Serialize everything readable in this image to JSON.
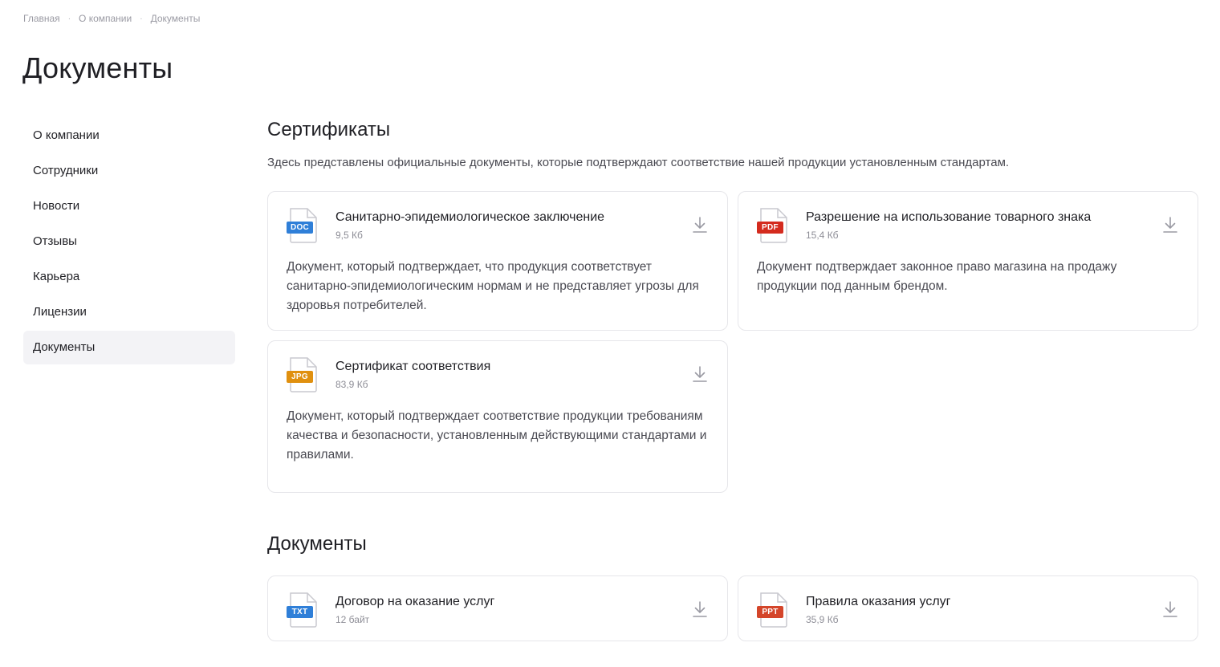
{
  "breadcrumb": [
    {
      "label": "Главная"
    },
    {
      "label": "О компании"
    },
    {
      "label": "Документы"
    }
  ],
  "page_title": "Документы",
  "sidebar": {
    "items": [
      {
        "label": "О компании"
      },
      {
        "label": "Сотрудники"
      },
      {
        "label": "Новости"
      },
      {
        "label": "Отзывы"
      },
      {
        "label": "Карьера"
      },
      {
        "label": "Лицензии"
      },
      {
        "label": "Документы",
        "active": true
      }
    ]
  },
  "colors": {
    "doc": "#2f7fd8",
    "pdf": "#d42b1e",
    "jpg": "#e0900f",
    "txt": "#2f7fd8",
    "ppt": "#d4452a",
    "active_bg": "#f3f3f6"
  },
  "certificates": {
    "title": "Сертификаты",
    "description": "Здесь представлены официальные документы, которые подтверждают соответствие нашей продукции установленным стандартам.",
    "items": [
      {
        "type": "DOC",
        "title": "Санитарно-эпидемиологическое заключение",
        "size": "9,5 Кб",
        "description": "Документ, который подтверждает, что продукция соответствует санитарно-эпидемиологическим нормам и не представляет угрозы для здоровья потребителей."
      },
      {
        "type": "PDF",
        "title": "Разрешение на использование товарного знака",
        "size": "15,4 Кб",
        "description": "Документ подтверждает законное право магазина на продажу продукции под данным брендом."
      },
      {
        "type": "JPG",
        "title": "Сертификат соответствия",
        "size": "83,9 Кб",
        "description": "Документ, который подтверждает соответствие продукции требованиям качества и безопасности, установленным действующими стандартами и правилами."
      }
    ]
  },
  "documents": {
    "title": "Документы",
    "items": [
      {
        "type": "TXT",
        "title": "Договор на оказание услуг",
        "size": "12 байт"
      },
      {
        "type": "PPT",
        "title": "Правила оказания услуг",
        "size": "35,9 Кб"
      }
    ]
  }
}
